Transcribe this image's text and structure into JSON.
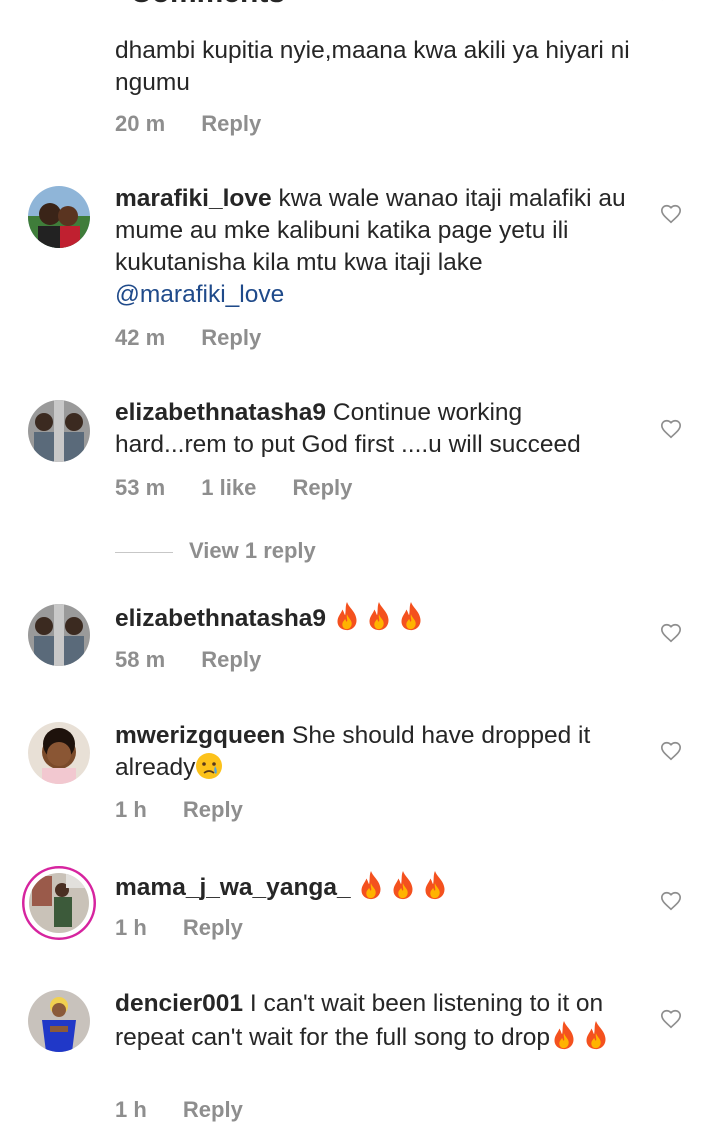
{
  "header": {
    "title": "Comments"
  },
  "reply_label": "Reply",
  "comments": [
    {
      "username": "",
      "text": "dhambi kupitia nyie,maana kwa akili ya hiyari ni ngumu",
      "time": "20 m"
    },
    {
      "username": "marafiki_love",
      "text": "kwa wale wanao itaji malafiki au mume au mke kalibuni katika page yetu ili kukutanisha kila mtu kwa itaji lake",
      "mention": "@marafiki_love",
      "time": "42 m"
    },
    {
      "username": "elizabethnatasha9",
      "text": "Continue working hard...rem to put God first ....u will succeed",
      "time": "53 m",
      "likes": "1 like",
      "view_replies": "View 1 reply"
    },
    {
      "username": "elizabethnatasha9",
      "text": "",
      "emojis": "fire x3",
      "time": "58 m"
    },
    {
      "username": "mwerizgqueen",
      "text": "She should have dropped it already",
      "emojis": "crying-face",
      "time": "1 h"
    },
    {
      "username": "mama_j_wa_yanga_",
      "text": "",
      "emojis": "fire x3",
      "time": "1 h"
    },
    {
      "username": "dencier001",
      "text": "I can't wait been listening to it on repeat can't wait for the full song to drop",
      "emojis": "fire x2",
      "time": "1 h"
    }
  ],
  "colors": {
    "text": "#262626",
    "meta": "#8e8e8e",
    "mention": "#1f4a8a",
    "fire": "#f4511e",
    "story_ring": "#d6249f"
  }
}
